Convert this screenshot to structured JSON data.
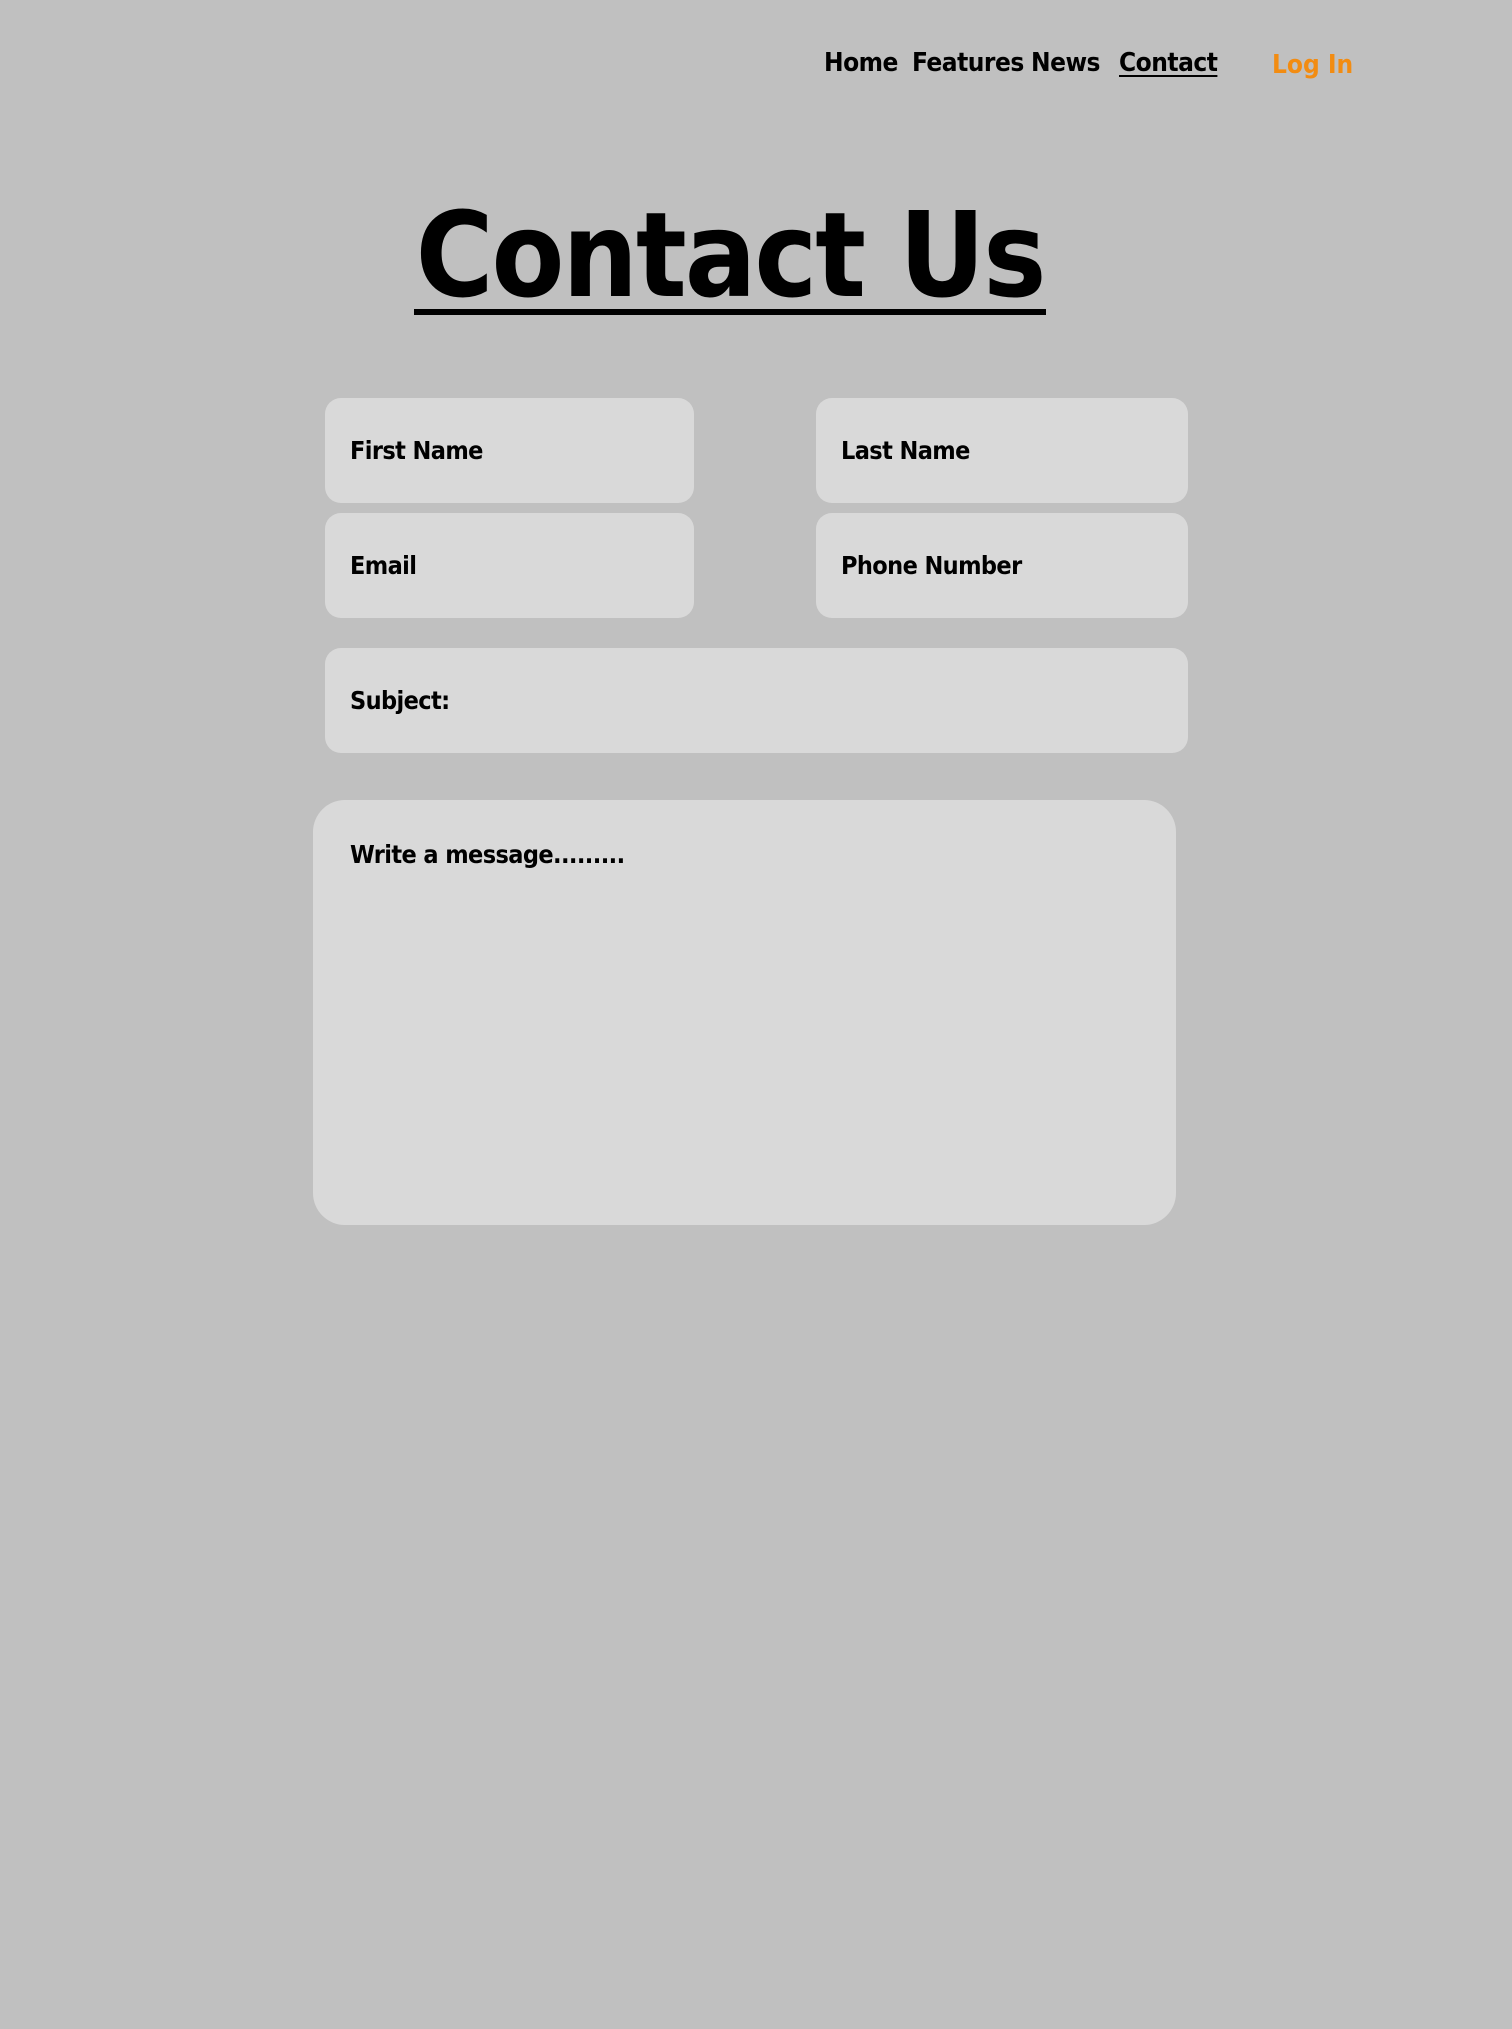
{
  "nav": {
    "items": [
      {
        "label": "Home"
      },
      {
        "label": "Features"
      },
      {
        "label": "News"
      },
      {
        "label": "Contact",
        "active": true
      }
    ],
    "login_label": "Log In"
  },
  "colors": {
    "background": "#c0c0c0",
    "field_background": "#d9d9d9",
    "accent": "#f28c12",
    "text": "#000000"
  },
  "page": {
    "title": "Contact Us"
  },
  "form": {
    "first_name_placeholder": "First Name",
    "last_name_placeholder": "Last Name",
    "email_placeholder": "Email",
    "phone_placeholder": "Phone Number",
    "subject_placeholder": "Subject:",
    "message_placeholder": "Write a message........."
  }
}
